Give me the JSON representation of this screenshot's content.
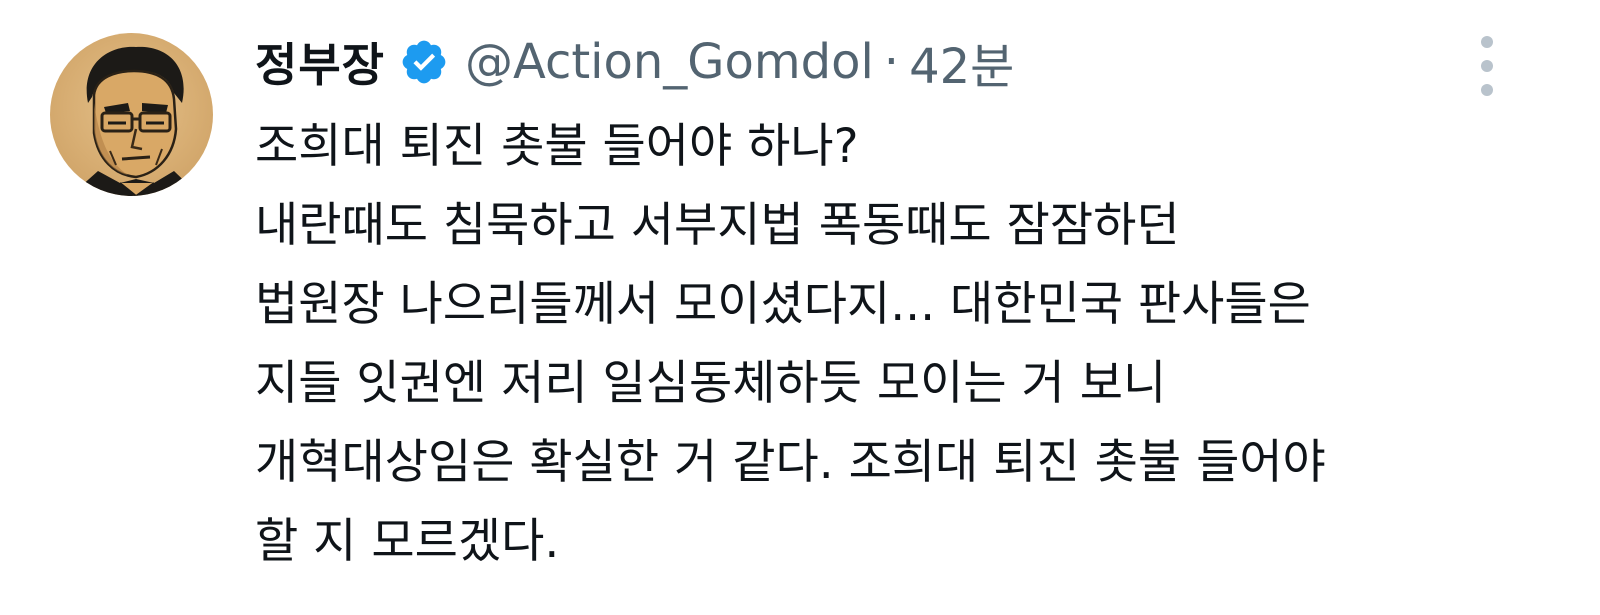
{
  "tweet": {
    "display_name": "정부장",
    "handle": "@Action_Gomdol",
    "separator": "·",
    "time": "42분",
    "verified_color": "#1d9bf0",
    "avatar_icon": "avatar-manga-portrait",
    "more_icon": "more-vertical-icon",
    "lines": [
      "조희대 퇴진 촛불 들어야 하나?",
      "내란때도 침묵하고 서부지법 폭동때도 잠잠하던",
      "법원장 나으리들께서 모이셨다지... 대한민국 판사들은",
      "지들 잇권엔 저리 일심동체하듯 모이는 거 보니",
      "개혁대상임은 확실한 거 같다. 조희대 퇴진 촛불 들어야",
      "할 지 모르겠다."
    ]
  }
}
